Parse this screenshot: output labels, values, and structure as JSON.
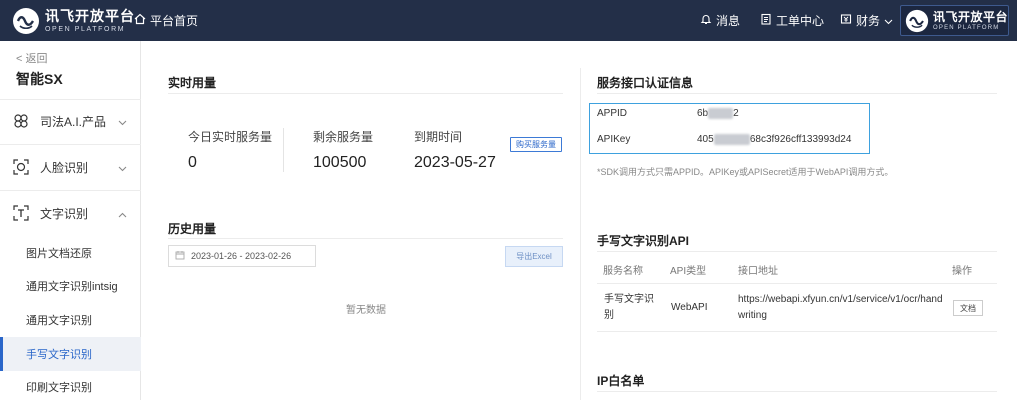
{
  "header": {
    "brand_name": "讯飞开放平台",
    "brand_sub": "OPEN PLATFORM",
    "home_label": "平台首页",
    "messages_label": "消息",
    "tickets_label": "工单中心",
    "finance_label": "财务"
  },
  "sidebar": {
    "back_label": "< 返回",
    "app_name": "智能SX",
    "groups": [
      {
        "label": "司法A.I.产品",
        "icon": "scales-icon"
      },
      {
        "label": "人脸识别",
        "icon": "face-scan-icon"
      },
      {
        "label": "文字识别",
        "icon": "text-scan-icon"
      }
    ],
    "sub_items": [
      {
        "label": "图片文档还原"
      },
      {
        "label": "通用文字识别intsig"
      },
      {
        "label": "通用文字识别"
      },
      {
        "label": "手写文字识别"
      },
      {
        "label": "印刷文字识别"
      }
    ]
  },
  "realtime": {
    "title": "实时用量",
    "today_label": "今日实时服务量",
    "today_value": "0",
    "remaining_label": "剩余服务量",
    "remaining_value": "100500",
    "expire_label": "到期时间",
    "expire_value": "2023-05-27",
    "buy_button": "购买服务量"
  },
  "history": {
    "title": "历史用量",
    "date_range": "2023-01-26 - 2023-02-26",
    "export_button": "导出Excel",
    "empty_text": "暂无数据"
  },
  "auth": {
    "title": "服务接口认证信息",
    "appid_label": "APPID",
    "appid_prefix": "6b",
    "appid_masked": "f6a3e",
    "appid_suffix": "2",
    "apikey_label": "APIKey",
    "apikey_prefix": "405",
    "apikey_masked": "44b1f5a",
    "apikey_suffix": "68c3f926cff133993d24",
    "note": "*SDK调用方式只需APPID。APIKey或APISecret适用于WebAPI调用方式。"
  },
  "api": {
    "title": "手写文字识别API",
    "columns": [
      "服务名称",
      "API类型",
      "接口地址",
      "操作"
    ],
    "row": {
      "name_line1": "手写文字识",
      "name_line2": "别",
      "type": "WebAPI",
      "url_line1": "https://webapi.xfyun.cn/v1/service/v1/ocr/hand",
      "url_line2": "writing",
      "action": "文档"
    }
  },
  "whitelist": {
    "title": "IP白名单"
  },
  "colors": {
    "topbar": "#232f48",
    "accent": "#2a66c9",
    "highlight_border": "#3ea1de"
  }
}
